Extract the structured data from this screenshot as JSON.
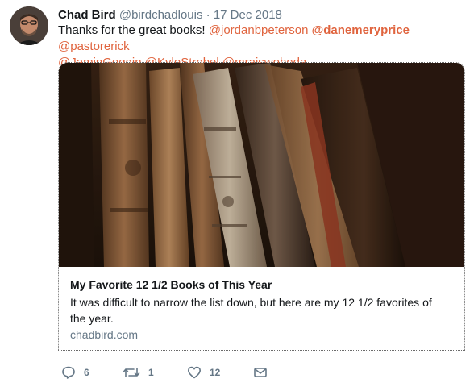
{
  "tweet": {
    "name": "Chad Bird",
    "handle": "@birdchadlouis",
    "separator": "·",
    "date": "17 Dec 2018",
    "text_prefix": "Thanks for the great books! ",
    "mentions": [
      "@jordanbpeterson",
      "@danemeryprice",
      "@pastorerick",
      "@JaminGoggin",
      "@KyleStrobel",
      "@mrajswoboda"
    ]
  },
  "card": {
    "title": "My Favorite 12 1/2 Books of This Year",
    "description": "It was difficult to narrow the list down, but here are my 12 1/2 favorites of the year.",
    "domain": "chadbird.com"
  },
  "actions": {
    "reply_count": "6",
    "retweet_count": "1",
    "like_count": "12"
  },
  "colors": {
    "mention": "#e0643e",
    "muted": "#657786",
    "text": "#14171a"
  }
}
